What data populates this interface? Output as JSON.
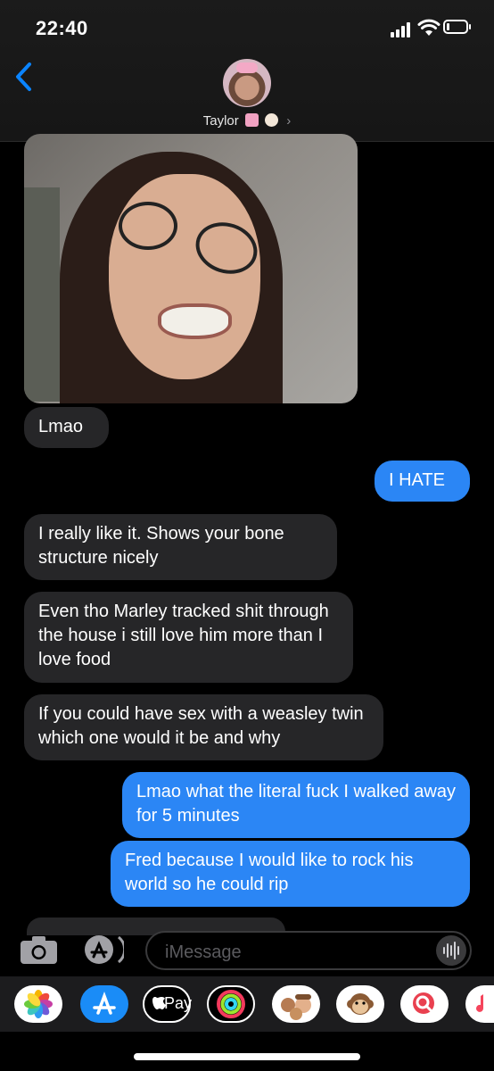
{
  "status_bar": {
    "time": "22:40"
  },
  "header": {
    "contact_name": "Taylor"
  },
  "messages": [
    {
      "type": "received",
      "text": "Lmao"
    },
    {
      "type": "sent",
      "text": "I HATE"
    },
    {
      "type": "received",
      "text": "I really like it. Shows your bone structure nicely"
    },
    {
      "type": "received",
      "text": "Even tho Marley tracked shit through the house i still love him more than I love food"
    },
    {
      "type": "received",
      "text": "If you could have sex with a weasley twin which one would it be and why"
    },
    {
      "type": "sent",
      "text": "Lmao what the literal fuck I walked away for 5 minutes"
    },
    {
      "type": "sent",
      "text": "Fred because I would like to rock his world so he could rip"
    }
  ],
  "compose": {
    "placeholder": "iMessage"
  },
  "app_drawer": {
    "apps": [
      "photos-app",
      "app-store-app",
      "apple-pay-app",
      "activity-app",
      "memoji-app",
      "animoji-app",
      "search-app",
      "music-app"
    ],
    "apple_pay_label": "Pay"
  },
  "colors": {
    "sent_bubble": "#2b86f5",
    "received_bubble": "#262628",
    "accent": "#0a84ff"
  }
}
